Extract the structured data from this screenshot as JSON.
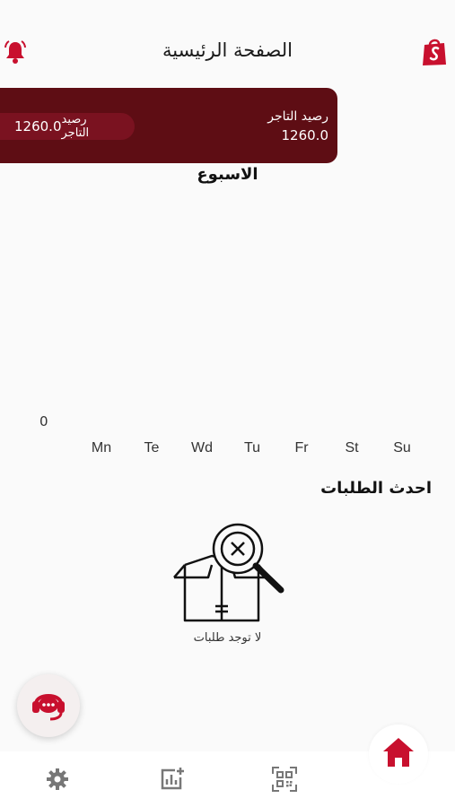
{
  "header": {
    "title": "الصفحة الرئيسية"
  },
  "balance_card": {
    "label": "رصيد التاجر",
    "amount": "1260.0",
    "pill_label": "رصيد التاجر",
    "pill_amount": "1260.0"
  },
  "week": {
    "title": "الاسبوع",
    "zero_label": "0",
    "days": [
      "Mn",
      "Te",
      "Wd",
      "Tu",
      "Fr",
      "St",
      "Su"
    ]
  },
  "orders": {
    "title": "احدث الطلبات",
    "empty_text": "لا توجد طلبات"
  },
  "icons": {
    "bell": "bell-icon",
    "shop": "shopping-bag-icon",
    "support": "support-headset-icon",
    "settings": "gear-icon",
    "stats": "add-chart-icon",
    "qr": "qr-scan-icon",
    "home": "home-icon"
  },
  "colors": {
    "brand": "#5e0d14",
    "accent": "#c8102e"
  }
}
